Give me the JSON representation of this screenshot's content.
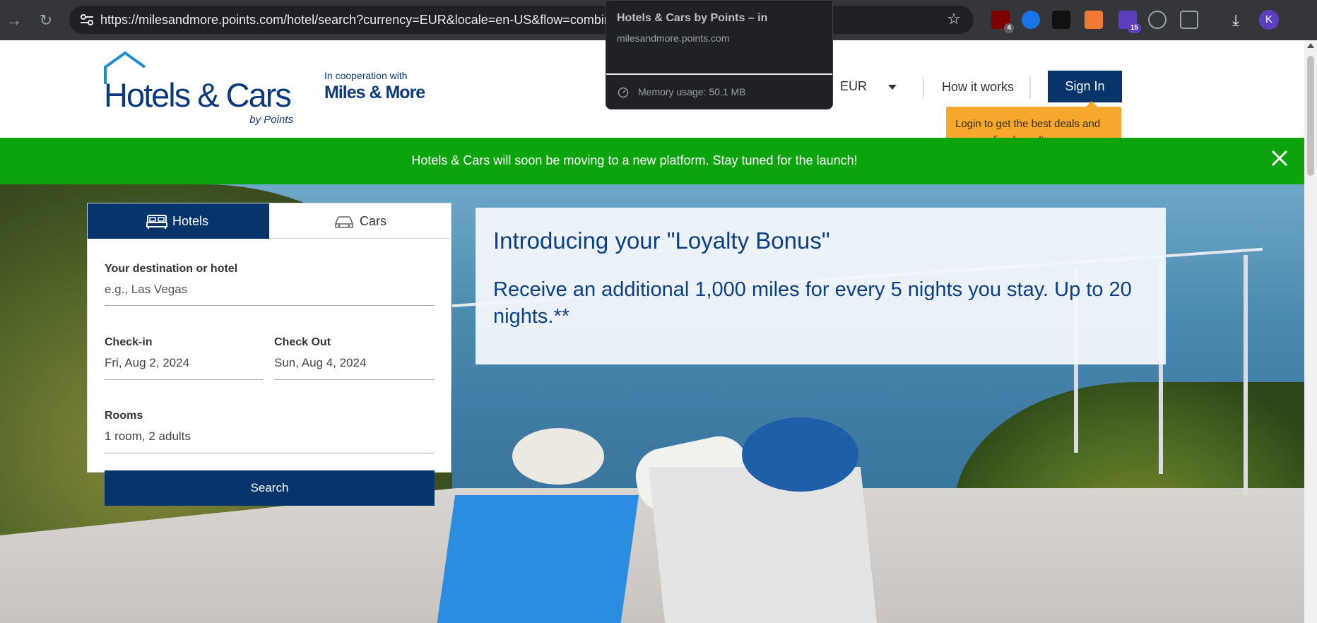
{
  "browser": {
    "url": "https://milesandmore.points.com/hotel/search?currency=EUR&locale=en-US&flow=combine",
    "extensions": [
      {
        "icon": "ublock-icon",
        "badge": "4",
        "color": "#800000"
      },
      {
        "icon": "sync-icon",
        "badge": "",
        "color": "#1a73e8"
      },
      {
        "icon": "robot-icon",
        "badge": "",
        "color": "#111111"
      },
      {
        "icon": "hubspot-icon",
        "badge": "",
        "color": "#f27a35"
      },
      {
        "icon": "graduation-icon",
        "badge": "15",
        "color": "#5b3fbf"
      },
      {
        "icon": "link-icon",
        "badge": "",
        "color": "#9aa0a6"
      },
      {
        "icon": "puzzle-icon",
        "badge": "",
        "color": "#9aa0a6"
      }
    ],
    "profile_initial": "K"
  },
  "hovercard": {
    "title": "Hotels & Cars by Points – in",
    "domain": "milesandmore.points.com",
    "memory": "Memory usage: 50.1 MB"
  },
  "header": {
    "logo_text": "Hotels & Cars",
    "logo_byline": "by Points",
    "coop_top": "In cooperation with",
    "coop_brand": "Miles & More",
    "currency": "EUR",
    "how_it_works": "How it works",
    "sign_in": "Sign In",
    "tooltip": "Login to get the best deals and personalized results."
  },
  "banner": {
    "text": "Hotels & Cars will soon be moving to a new platform. Stay tuned for the launch!"
  },
  "search": {
    "tabs": [
      {
        "label": "Hotels",
        "active": true
      },
      {
        "label": "Cars",
        "active": false
      }
    ],
    "destination_label": "Your destination or hotel",
    "destination_placeholder": "e.g., Las Vegas",
    "checkin_label": "Check-in",
    "checkin_value": "Fri, Aug 2, 2024",
    "checkout_label": "Check Out",
    "checkout_value": "Sun, Aug 4, 2024",
    "rooms_label": "Rooms",
    "rooms_value": "1 room, 2 adults",
    "search_button": "Search"
  },
  "promo": {
    "title": "Introducing your \"Loyalty Bonus\"",
    "body": "Receive an additional 1,000 miles for every 5 nights you stay. Up to 20 nights.**"
  },
  "colors": {
    "brand_navy": "#06346b",
    "banner_green": "#0ca40c",
    "tooltip_orange": "#f6a82c"
  }
}
